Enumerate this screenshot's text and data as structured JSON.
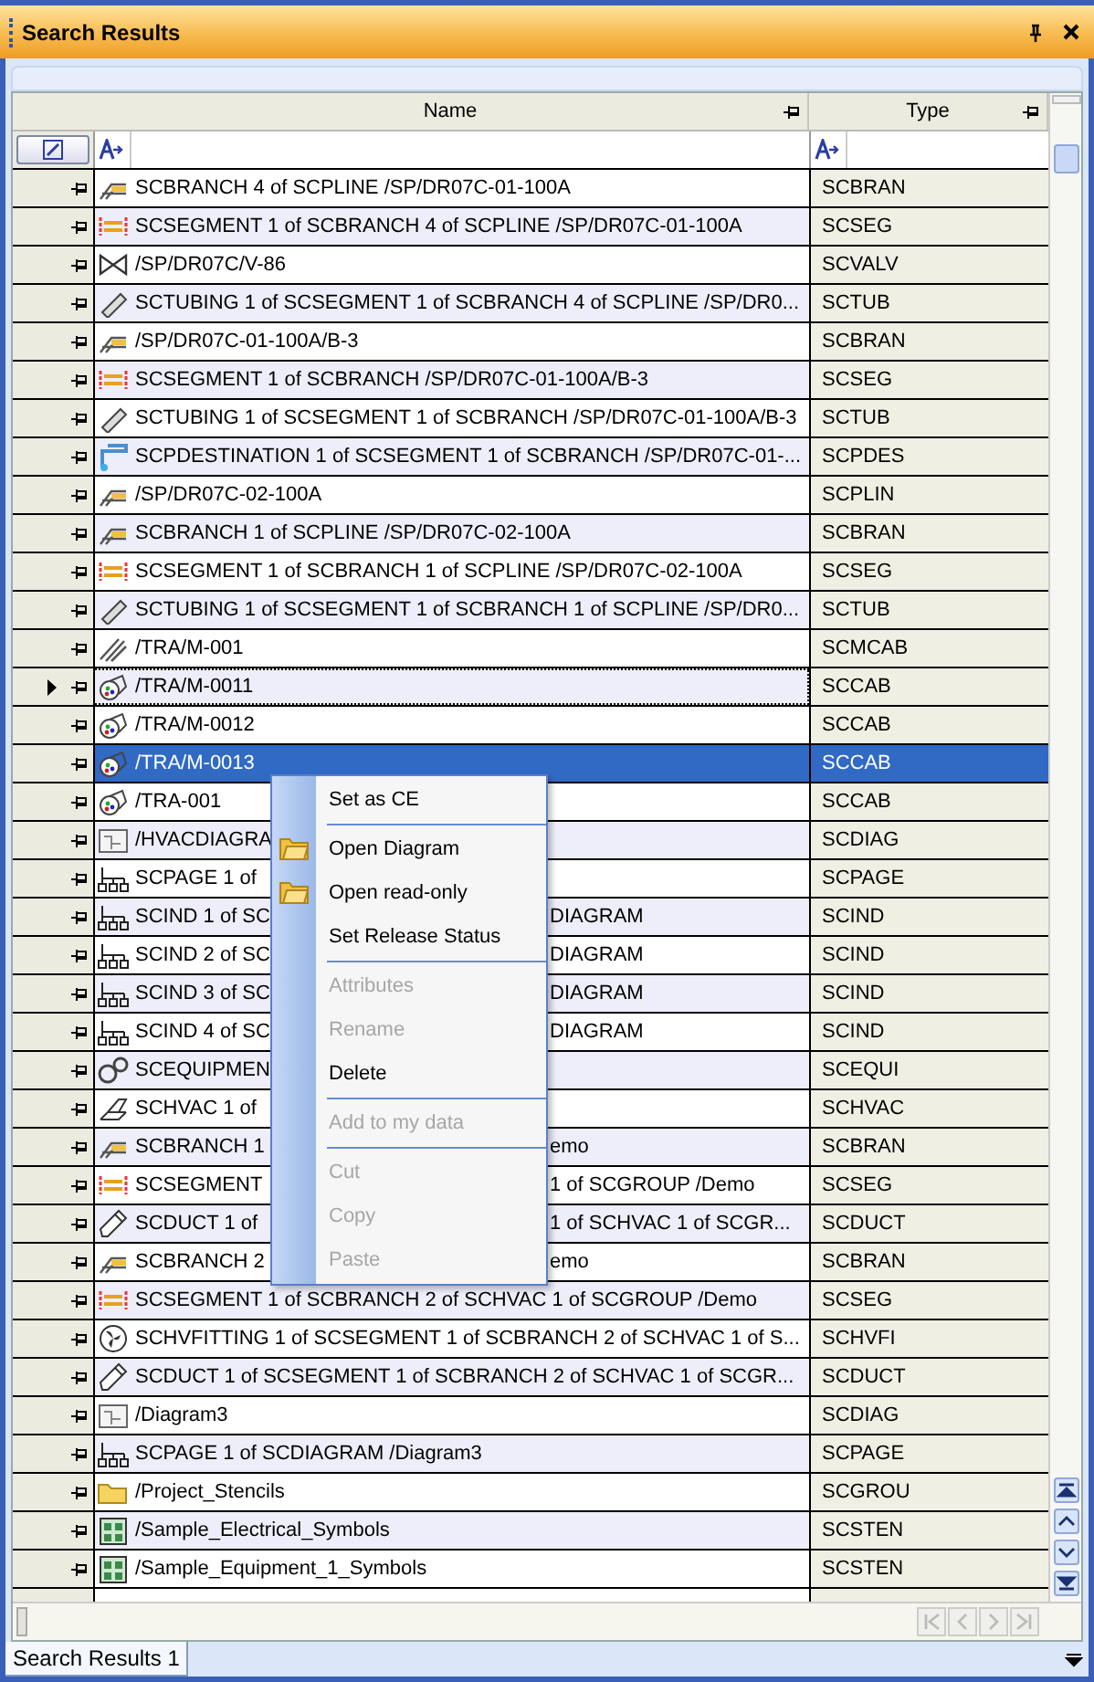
{
  "window": {
    "title": "Search Results"
  },
  "table": {
    "columns": [
      {
        "label": "Name"
      },
      {
        "label": "Type"
      }
    ],
    "rows": [
      {
        "kind": "branch",
        "name": "SCBRANCH 4 of SCPLINE /SP/DR07C-01-100A",
        "type": "SCBRAN",
        "selected": false,
        "current": false
      },
      {
        "kind": "segment",
        "name": "SCSEGMENT 1 of SCBRANCH 4 of SCPLINE /SP/DR07C-01-100A",
        "type": "SCSEG",
        "selected": false,
        "current": false
      },
      {
        "kind": "valve",
        "name": "/SP/DR07C/V-86",
        "type": "SCVALV",
        "selected": false,
        "current": false
      },
      {
        "kind": "tube",
        "name": "SCTUBING 1 of SCSEGMENT 1 of SCBRANCH 4 of SCPLINE /SP/DR0...",
        "type": "SCTUB",
        "selected": false,
        "current": false
      },
      {
        "kind": "branch",
        "name": "/SP/DR07C-01-100A/B-3",
        "type": "SCBRAN",
        "selected": false,
        "current": false
      },
      {
        "kind": "segment",
        "name": "SCSEGMENT 1 of SCBRANCH /SP/DR07C-01-100A/B-3",
        "type": "SCSEG",
        "selected": false,
        "current": false
      },
      {
        "kind": "tube",
        "name": "SCTUBING 1 of SCSEGMENT 1 of SCBRANCH /SP/DR07C-01-100A/B-3",
        "type": "SCTUB",
        "selected": false,
        "current": false
      },
      {
        "kind": "destination",
        "name": "SCPDESTINATION 1 of SCSEGMENT 1 of SCBRANCH /SP/DR07C-01-...",
        "type": "SCPDES",
        "selected": false,
        "current": false
      },
      {
        "kind": "branch",
        "name": "/SP/DR07C-02-100A",
        "type": "SCPLIN",
        "selected": false,
        "current": false
      },
      {
        "kind": "branch",
        "name": "SCBRANCH 1 of SCPLINE /SP/DR07C-02-100A",
        "type": "SCBRAN",
        "selected": false,
        "current": false
      },
      {
        "kind": "segment",
        "name": "SCSEGMENT 1 of SCBRANCH 1 of SCPLINE /SP/DR07C-02-100A",
        "type": "SCSEG",
        "selected": false,
        "current": false
      },
      {
        "kind": "tube",
        "name": "SCTUBING 1 of SCSEGMENT 1 of SCBRANCH 1 of SCPLINE /SP/DR0...",
        "type": "SCTUB",
        "selected": false,
        "current": false
      },
      {
        "kind": "cables",
        "name": "/TRA/M-001",
        "type": "SCMCAB",
        "selected": false,
        "current": false
      },
      {
        "kind": "cable",
        "name": "/TRA/M-0011",
        "type": "SCCAB",
        "selected": false,
        "current": true
      },
      {
        "kind": "cable",
        "name": "/TRA/M-0012",
        "type": "SCCAB",
        "selected": false,
        "current": false
      },
      {
        "kind": "cable",
        "name": "/TRA/M-0013",
        "type": "SCCAB",
        "selected": true,
        "current": false
      },
      {
        "kind": "cable",
        "name": "/TRA-001",
        "type": "SCCAB",
        "selected": false,
        "current": false
      },
      {
        "kind": "diagram",
        "name": "/HVACDIAGRA",
        "type": "SCDIAG",
        "selected": false,
        "current": false
      },
      {
        "kind": "page",
        "name": "SCPAGE 1 of",
        "type": "SCPAGE",
        "selected": false,
        "current": false
      },
      {
        "kind": "page",
        "name": "SCIND 1 of SC",
        "name_after": "DIAGRAM",
        "type": "SCIND",
        "selected": false,
        "current": false
      },
      {
        "kind": "page",
        "name": "SCIND 2 of SC",
        "name_after": "DIAGRAM",
        "type": "SCIND",
        "selected": false,
        "current": false
      },
      {
        "kind": "page",
        "name": "SCIND 3 of SC",
        "name_after": "DIAGRAM",
        "type": "SCIND",
        "selected": false,
        "current": false
      },
      {
        "kind": "page",
        "name": "SCIND 4 of SC",
        "name_after": "DIAGRAM",
        "type": "SCIND",
        "selected": false,
        "current": false
      },
      {
        "kind": "equipment",
        "name": "SCEQUIPMEN",
        "type": "SCEQUI",
        "selected": false,
        "current": false
      },
      {
        "kind": "hvac",
        "name": "SCHVAC 1 of",
        "type": "SCHVAC",
        "selected": false,
        "current": false
      },
      {
        "kind": "branch",
        "name": "SCBRANCH 1",
        "name_after": "emo",
        "type": "SCBRAN",
        "selected": false,
        "current": false
      },
      {
        "kind": "segment",
        "name": "SCSEGMENT",
        "name_after": "1 of SCGROUP /Demo",
        "type": "SCSEG",
        "selected": false,
        "current": false
      },
      {
        "kind": "duct",
        "name": "SCDUCT 1 of",
        "name_after": "1 of SCHVAC 1 of SCGR...",
        "type": "SCDUCT",
        "selected": false,
        "current": false
      },
      {
        "kind": "branch",
        "name": "SCBRANCH 2",
        "name_after": "emo",
        "type": "SCBRAN",
        "selected": false,
        "current": false
      },
      {
        "kind": "segment",
        "name": "SCSEGMENT 1 of SCBRANCH 2 of SCHVAC 1 of SCGROUP /Demo",
        "type": "SCSEG",
        "selected": false,
        "current": false
      },
      {
        "kind": "fitting",
        "name": "SCHVFITTING 1 of SCSEGMENT 1 of SCBRANCH 2 of SCHVAC 1 of S...",
        "type": "SCHVFI",
        "selected": false,
        "current": false
      },
      {
        "kind": "duct",
        "name": "SCDUCT 1 of SCSEGMENT 1 of SCBRANCH 2 of SCHVAC 1 of SCGR...",
        "type": "SCDUCT",
        "selected": false,
        "current": false
      },
      {
        "kind": "diagram",
        "name": "/Diagram3",
        "type": "SCDIAG",
        "selected": false,
        "current": false
      },
      {
        "kind": "page",
        "name": "SCPAGE 1 of SCDIAGRAM /Diagram3",
        "type": "SCPAGE",
        "selected": false,
        "current": false
      },
      {
        "kind": "folder",
        "name": "/Project_Stencils",
        "type": "SCGROU",
        "selected": false,
        "current": false
      },
      {
        "kind": "stencil",
        "name": "/Sample_Electrical_Symbols",
        "type": "SCSTEN",
        "selected": false,
        "current": false
      },
      {
        "kind": "stencil",
        "name": "/Sample_Equipment_1_Symbols",
        "type": "SCSTEN",
        "selected": false,
        "current": false
      }
    ]
  },
  "context_menu": {
    "items": [
      {
        "kind": "item",
        "label": "Set as CE",
        "disabled": false
      },
      {
        "kind": "separator"
      },
      {
        "kind": "icon_item",
        "label": "Open Diagram",
        "disabled": false
      },
      {
        "kind": "icon_item",
        "label": "Open read-only",
        "disabled": false
      },
      {
        "kind": "item",
        "label": "Set Release Status",
        "disabled": false
      },
      {
        "kind": "separator"
      },
      {
        "kind": "item",
        "label": "Attributes",
        "disabled": true
      },
      {
        "kind": "item",
        "label": "Rename",
        "disabled": true
      },
      {
        "kind": "item",
        "label": "Delete",
        "disabled": false
      },
      {
        "kind": "separator"
      },
      {
        "kind": "item",
        "label": "Add to my data",
        "disabled": true
      },
      {
        "kind": "separator"
      },
      {
        "kind": "item",
        "label": "Cut",
        "disabled": true
      },
      {
        "kind": "item",
        "label": "Copy",
        "disabled": true
      },
      {
        "kind": "item",
        "label": "Paste",
        "disabled": true
      }
    ]
  },
  "tabs": [
    {
      "label": "Search Results 1",
      "selected": true
    }
  ]
}
